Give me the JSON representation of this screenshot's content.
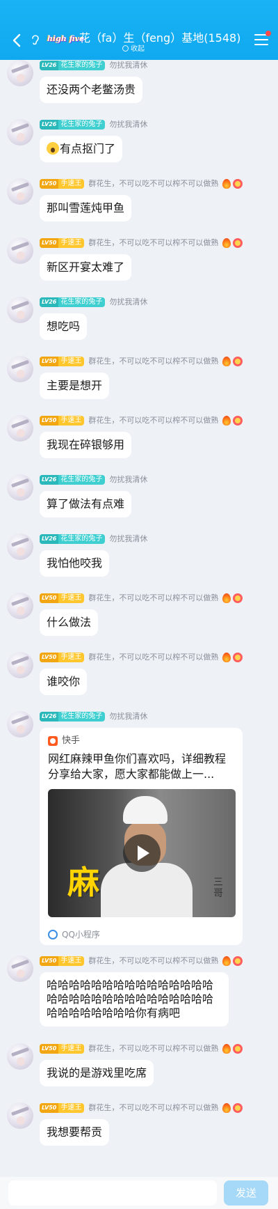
{
  "header": {
    "hi_badge": "high five",
    "title": "花（fa）生（feng）基地(1548)",
    "collapse_label": "收起"
  },
  "colors": {
    "header_bg": "#1ab3f5",
    "accent": "#10a8ef",
    "bubble_bg": "#ffffff",
    "page_bg": "#eef1f6"
  },
  "messages": [
    {
      "lv": "LV26",
      "title": "花生家的兔子",
      "nick": "勿扰我清休",
      "text": "还没两个老鳖汤贵"
    },
    {
      "lv": "LV26",
      "title": "花生家的兔子",
      "nick": "勿扰我清休",
      "text": "有点抠门了"
    },
    {
      "lv": "LV50",
      "title": "手速王",
      "nick": "群花生，不可以吃不可以榨不可以做熟",
      "text": "那叫雪莲炖甲鱼"
    },
    {
      "lv": "LV50",
      "title": "手速王",
      "nick": "群花生，不可以吃不可以榨不可以做熟",
      "text": "新区开宴太难了"
    },
    {
      "lv": "LV26",
      "title": "花生家的兔子",
      "nick": "勿扰我清休",
      "text": "想吃吗"
    },
    {
      "lv": "LV50",
      "title": "手速王",
      "nick": "群花生，不可以吃不可以榨不可以做熟",
      "text": "主要是想开"
    },
    {
      "lv": "LV50",
      "title": "手速王",
      "nick": "群花生，不可以吃不可以榨不可以做熟",
      "text": "我现在碎银够用"
    },
    {
      "lv": "LV26",
      "title": "花生家的兔子",
      "nick": "勿扰我清休",
      "text": "算了做法有点难"
    },
    {
      "lv": "LV26",
      "title": "花生家的兔子",
      "nick": "勿扰我清休",
      "text": "我怕他咬我"
    },
    {
      "lv": "LV50",
      "title": "手速王",
      "nick": "群花生，不可以吃不可以榨不可以做熟",
      "text": "什么做法"
    },
    {
      "lv": "LV50",
      "title": "手速王",
      "nick": "群花生，不可以吃不可以榨不可以做熟",
      "text": "谁咬你"
    },
    {
      "lv": "LV26",
      "title": "花生家的兔子",
      "nick": "勿扰我清休",
      "card": {
        "source": "快手",
        "title": "网红麻辣甲鱼你们喜欢吗，详细教程分享给大家，愿大家都能做上一...",
        "overlay": "麻",
        "side_text": "三哥",
        "footer": "QQ小程序"
      }
    },
    {
      "lv": "LV50",
      "title": "手速王",
      "nick": "群花生，不可以吃不可以榨不可以做熟",
      "text": "哈哈哈哈哈哈哈哈哈哈哈哈哈哈哈哈哈哈哈哈哈哈哈哈哈哈哈哈哈哈哈哈哈哈哈哈哈哈你有病吧"
    },
    {
      "lv": "LV50",
      "title": "手速王",
      "nick": "群花生，不可以吃不可以榨不可以做熟",
      "text": "我说的是游戏里吃席"
    },
    {
      "lv": "LV50",
      "title": "手速王",
      "nick": "群花生，不可以吃不可以榨不可以做熟",
      "text": "我想要帮贡"
    }
  ],
  "composer": {
    "input_value": "",
    "send_label": "发送"
  }
}
